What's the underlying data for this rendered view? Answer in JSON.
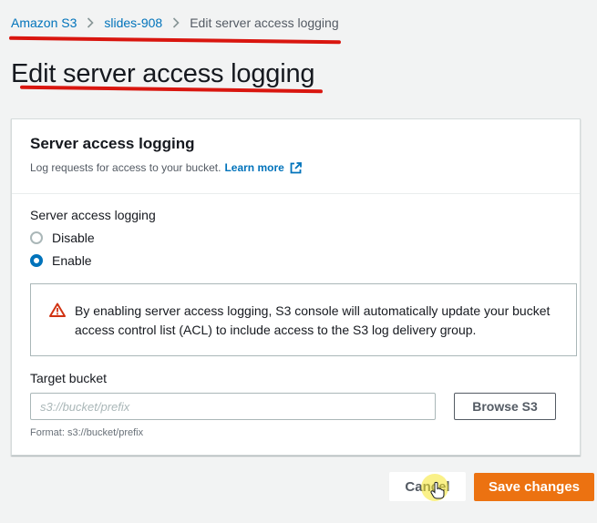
{
  "breadcrumb": {
    "items": [
      {
        "label": "Amazon S3"
      },
      {
        "label": "slides-908"
      }
    ],
    "current": "Edit server access logging"
  },
  "page": {
    "title": "Edit server access logging"
  },
  "panel": {
    "title": "Server access logging",
    "description": "Log requests for access to your bucket.",
    "learn_more": "Learn more",
    "field_label": "Server access logging",
    "options": [
      {
        "label": "Disable",
        "selected": false
      },
      {
        "label": "Enable",
        "selected": true
      }
    ],
    "alert": {
      "icon": "warning-triangle-icon",
      "text": "By enabling server access logging, S3 console will automatically update your bucket access control list (ACL) to include access to the S3 log delivery group."
    },
    "target_bucket": {
      "label": "Target bucket",
      "value": "",
      "placeholder": "s3://bucket/prefix",
      "browse_label": "Browse S3",
      "hint": "Format: s3://bucket/prefix"
    }
  },
  "actions": {
    "cancel_label": "Cancel",
    "save_label": "Save changes"
  },
  "colors": {
    "link": "#0073bb",
    "primary": "#ec7211",
    "annotation": "#d9160f",
    "warning": "#d13212"
  }
}
